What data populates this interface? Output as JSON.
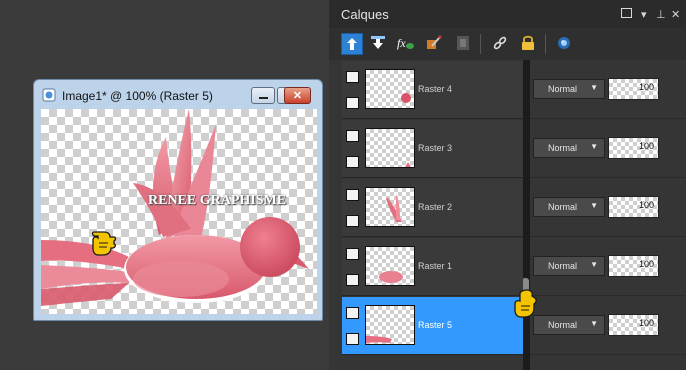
{
  "image_window": {
    "title": "Image1* @ 100% (Raster 5)",
    "watermark": "RENEE GRAPHISME",
    "buttons": [
      {
        "name": "minimize",
        "icon": "minimize-icon"
      },
      {
        "name": "maximize",
        "icon": "maximize-icon"
      },
      {
        "name": "close",
        "icon": "close-icon"
      }
    ]
  },
  "layers_panel": {
    "title": "Calques",
    "header_icons": [
      "window-icon",
      "dropdown-icon",
      "pin-icon",
      "close-icon"
    ],
    "toolbar": [
      "move-layer-up-icon",
      "move-layer-down-icon",
      "layer-effects-icon",
      "brush-icon",
      "mask-icon",
      "link-icon",
      "lock-icon",
      "visibility-icon"
    ],
    "layers": [
      {
        "name": "Raster 4",
        "blend": "Normal",
        "opacity": "100",
        "selected": false
      },
      {
        "name": "Raster 3",
        "blend": "Normal",
        "opacity": "100",
        "selected": false
      },
      {
        "name": "Raster 2",
        "blend": "Normal",
        "opacity": "100",
        "selected": false
      },
      {
        "name": "Raster 1",
        "blend": "Normal",
        "opacity": "100",
        "selected": false
      },
      {
        "name": "Raster 5",
        "blend": "Normal",
        "opacity": "100",
        "selected": true
      }
    ]
  },
  "colors": {
    "accent": "#3399ff",
    "bird_pink": "#e56f80",
    "bird_dark": "#c9505f",
    "pointer_yellow": "#f5c400"
  }
}
